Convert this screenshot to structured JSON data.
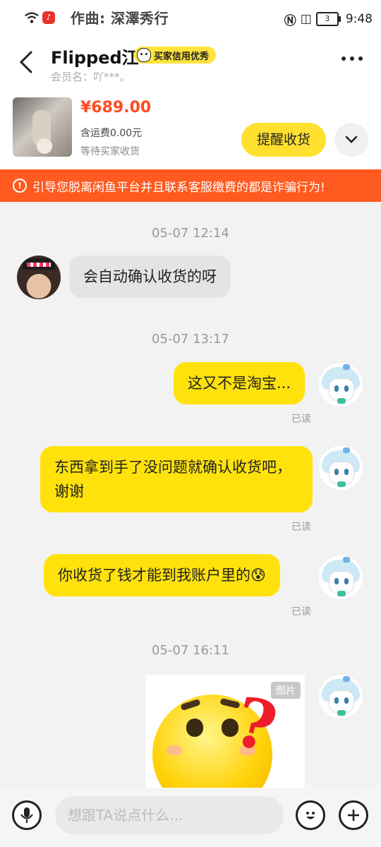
{
  "status_bar": {
    "now_playing": "作曲: 深澤秀行",
    "battery": "3",
    "time": "9:48"
  },
  "header": {
    "name": "Flipped江",
    "badge": "买家信用优秀",
    "member": "会员名：吖***。"
  },
  "order": {
    "price": "¥689.00",
    "shipping": "含运费0.00元",
    "status": "等待买家收货",
    "remind_label": "提醒收货"
  },
  "warning": "引导您脱离闲鱼平台并且联系客服缴费的都是诈骗行为!",
  "messages": {
    "ts1": "05-07 12:14",
    "m1": "会自动确认收货的呀",
    "ts2": "05-07 13:17",
    "m2": "这又不是淘宝...",
    "read2": "已读",
    "m3": "东西拿到手了没问题就确认收货吧，谢谢",
    "read3": "已读",
    "m4": "你收货了钱才能到我账户里的😰",
    "read4": "已读",
    "ts3": "05-07 16:11",
    "image_tag": "图片"
  },
  "input": {
    "placeholder": "想跟TA说点什么..."
  },
  "colors": {
    "accent_yellow": "#ffe20c",
    "warning_orange": "#ff5a1f",
    "price_red": "#ff4b1f"
  }
}
